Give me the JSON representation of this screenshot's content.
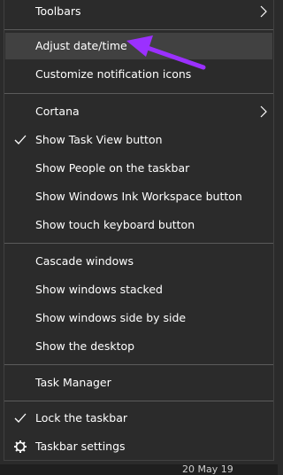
{
  "menu": {
    "items": [
      {
        "label": "Toolbars",
        "submenu": true
      },
      {
        "label": "Adjust date/time",
        "highlighted": true
      },
      {
        "label": "Customize notification icons"
      },
      {
        "label": "Cortana",
        "submenu": true
      },
      {
        "label": "Show Task View button",
        "checked": true
      },
      {
        "label": "Show People on the taskbar"
      },
      {
        "label": "Show Windows Ink Workspace button"
      },
      {
        "label": "Show touch keyboard button"
      },
      {
        "label": "Cascade windows"
      },
      {
        "label": "Show windows stacked"
      },
      {
        "label": "Show windows side by side"
      },
      {
        "label": "Show the desktop"
      },
      {
        "label": "Task Manager"
      },
      {
        "label": "Lock the taskbar",
        "checked": true
      },
      {
        "label": "Taskbar settings",
        "icon": "gear-icon"
      }
    ]
  },
  "annotation": {
    "icon": "arrow-pointer-icon",
    "color": "#9b30ff"
  },
  "taskbar": {
    "partial_date_text": "20 May 19"
  },
  "colors": {
    "menu_bg": "#2b2b2b",
    "highlight_bg": "#414141",
    "text": "#ffffff",
    "separator": "#5b5b5b"
  }
}
